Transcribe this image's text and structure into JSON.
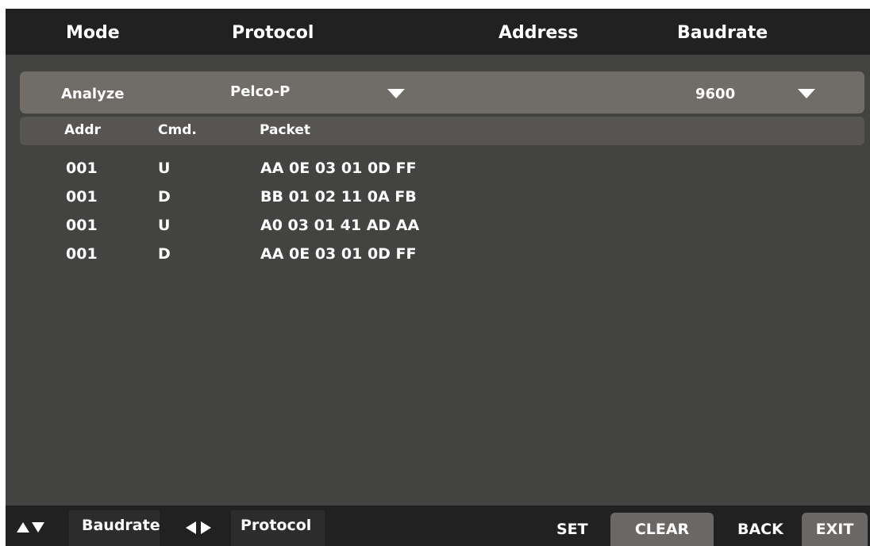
{
  "header": {
    "mode": "Mode",
    "protocol": "Protocol",
    "address": "Address",
    "baudrate": "Baudrate"
  },
  "selection": {
    "mode": "Analyze",
    "protocol": "Pelco-P",
    "baudrate": "9600"
  },
  "columns": {
    "addr": "Addr",
    "cmd": "Cmd.",
    "packet": "Packet"
  },
  "rows": [
    {
      "addr": "001",
      "cmd": "U",
      "packet": "AA 0E 03 01 0D FF"
    },
    {
      "addr": "001",
      "cmd": "D",
      "packet": "BB 01 02 11 0A FB"
    },
    {
      "addr": "001",
      "cmd": "U",
      "packet": "A0 03 01 41 AD AA"
    },
    {
      "addr": "001",
      "cmd": "D",
      "packet": "AA 0E 03 01 0D FF"
    }
  ],
  "footer": {
    "updown_hint": "Baudrate",
    "leftright_hint": "Protocol",
    "set": "SET",
    "clear": "CLEAR",
    "back": "BACK",
    "exit": "EXIT"
  },
  "icons": {
    "protocol_dropdown": "triangle-down-icon",
    "baudrate_dropdown": "triangle-down-icon",
    "up": "up-arrow-icon",
    "down": "down-arrow-icon",
    "left": "left-arrow-icon",
    "right": "right-arrow-icon"
  }
}
